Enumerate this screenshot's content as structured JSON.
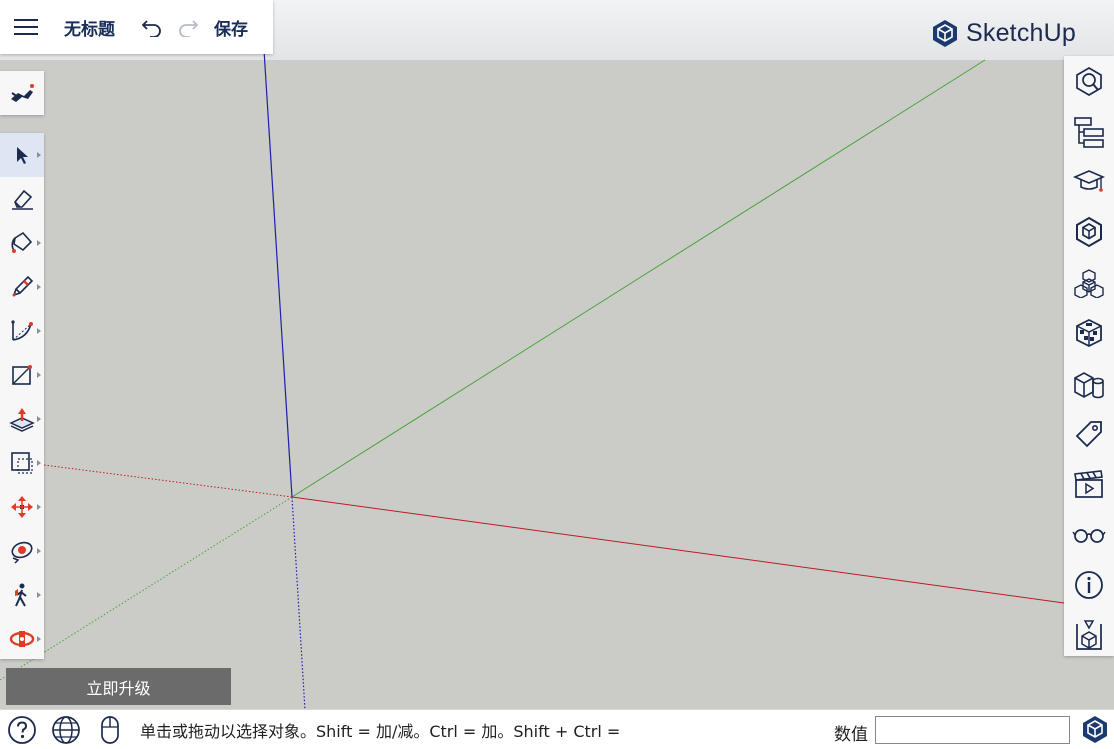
{
  "titlebar": {
    "doc_title": "无标题",
    "save_label": "保存"
  },
  "brand": {
    "name": "SketchUp"
  },
  "upgrade": {
    "label": "立即升级"
  },
  "statusbar": {
    "hint": "单击或拖动以选择对象。Shift = 加/减。Ctrl = 加。Shift + Ctrl =",
    "measure_label": "数值",
    "measure_value": ""
  },
  "left_tools": [
    "select-tool",
    "eraser-tool",
    "paint-bucket-tool",
    "pencil-tool",
    "arc-tool",
    "rectangle-tool",
    "push-pull-tool",
    "offset-tool",
    "move-tool",
    "orbit-tool",
    "walk-tool",
    "rotate-tool"
  ],
  "right_panels": [
    "search-3d-warehouse-icon",
    "outliner-icon",
    "instructor-icon",
    "components-icon",
    "entity-info-icon",
    "materials-icon",
    "styles-icon",
    "tags-icon",
    "scenes-icon",
    "display-icon",
    "model-info-icon",
    "solid-inspector-icon"
  ],
  "colors": {
    "red_axis": "#b81e1e",
    "green_axis": "#4aa43a",
    "blue_axis": "#1e1eaa",
    "ground": "#cbccc8",
    "accent_red": "#e03b24",
    "navy": "#1c2a4f"
  }
}
